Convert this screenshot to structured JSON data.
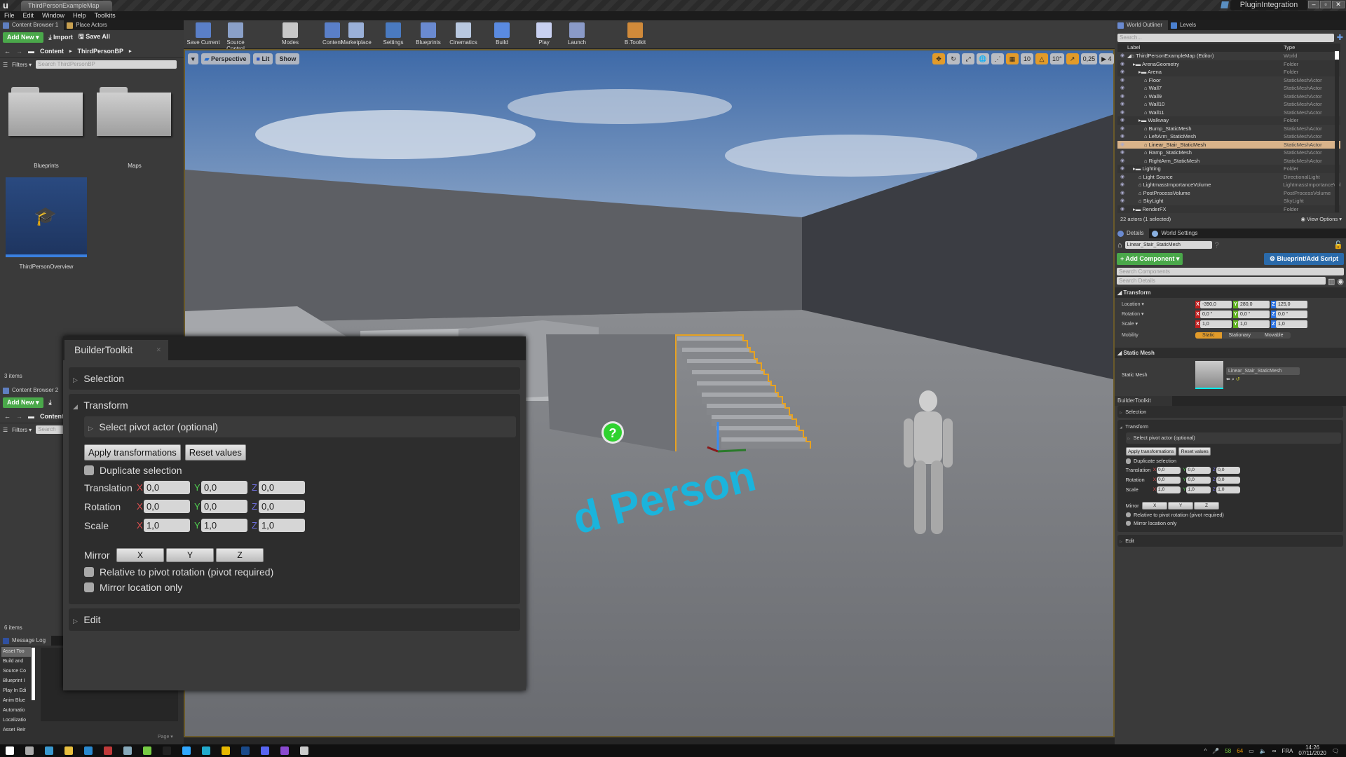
{
  "window": {
    "map_tab": "ThirdPersonExampleMap",
    "project_name": "PluginIntegration",
    "controls": [
      "minimize",
      "maximize",
      "close"
    ]
  },
  "menu": [
    "File",
    "Edit",
    "Window",
    "Help",
    "Toolkits"
  ],
  "content_browser_1": {
    "tabs": [
      {
        "label": "Content Browser 1"
      },
      {
        "label": "Place Actors"
      }
    ],
    "add_new": "Add New ▾",
    "import": "Import",
    "save_all": "Save All",
    "breadcrumb": [
      "Content",
      "ThirdPersonBP"
    ],
    "filters": "Filters ▾",
    "search_placeholder": "Search ThirdPersonBP",
    "assets": [
      {
        "label": "Blueprints",
        "type": "folder"
      },
      {
        "label": "Maps",
        "type": "folder"
      },
      {
        "label": "ThirdPersonOverview",
        "type": "tutorial"
      }
    ],
    "item_count": "3 items"
  },
  "content_browser_2": {
    "tab": "Content Browser 2",
    "add_new": "Add New ▾",
    "breadcrumb": [
      "Content"
    ],
    "filters": "Filters ▾",
    "search_placeholder": "Search",
    "item_count": "6 items"
  },
  "message_log": {
    "tab": "Message Log",
    "categories": [
      "Asset Too",
      "Build and",
      "Source Co",
      "Blueprint I",
      "Play In Edi",
      "Anim Blue",
      "Automatio",
      "Localizatio",
      "Asset Reir"
    ],
    "page_label": "Page ▾"
  },
  "toolbar": [
    {
      "label": "Save Current",
      "icon": "save-icon"
    },
    {
      "label": "Source Control",
      "icon": "source-control-icon"
    },
    {
      "label": "Modes",
      "icon": "modes-icon"
    },
    {
      "label": "Content",
      "icon": "content-icon"
    },
    {
      "label": "Marketplace",
      "icon": "marketplace-icon"
    },
    {
      "label": "Settings",
      "icon": "settings-icon"
    },
    {
      "label": "Blueprints",
      "icon": "blueprints-icon"
    },
    {
      "label": "Cinematics",
      "icon": "cinematics-icon"
    },
    {
      "label": "Build",
      "icon": "build-icon"
    },
    {
      "label": "Play",
      "icon": "play-icon"
    },
    {
      "label": "Launch",
      "icon": "launch-icon"
    },
    {
      "label": "B.Toolkit",
      "icon": "builder-toolkit-icon"
    }
  ],
  "viewport": {
    "left_buttons": [
      "▾",
      "Perspective",
      "Lit",
      "Show"
    ],
    "grid_snap": "10",
    "rotation_snap": "10°",
    "scale_snap": "0,25",
    "camera_speed": "4",
    "floor_text": "d Person"
  },
  "world_outliner": {
    "tabs": [
      "World Outliner",
      "Levels"
    ],
    "search_placeholder": "Search...",
    "columns": [
      "Label",
      "Type"
    ],
    "rows": [
      {
        "label": "ThirdPersonExampleMap (Editor)",
        "type": "World",
        "depth": 0
      },
      {
        "label": "ArenaGeometry",
        "type": "Folder",
        "depth": 1
      },
      {
        "label": "Arena",
        "type": "Folder",
        "depth": 2
      },
      {
        "label": "Floor",
        "type": "StaticMeshActor",
        "depth": 3
      },
      {
        "label": "Wall7",
        "type": "StaticMeshActor",
        "depth": 3
      },
      {
        "label": "Wall9",
        "type": "StaticMeshActor",
        "depth": 3
      },
      {
        "label": "Wall10",
        "type": "StaticMeshActor",
        "depth": 3
      },
      {
        "label": "Wall11",
        "type": "StaticMeshActor",
        "depth": 3
      },
      {
        "label": "Walkway",
        "type": "Folder",
        "depth": 2
      },
      {
        "label": "Bump_StaticMesh",
        "type": "StaticMeshActor",
        "depth": 3
      },
      {
        "label": "LeftArm_StaticMesh",
        "type": "StaticMeshActor",
        "depth": 3
      },
      {
        "label": "Linear_Stair_StaticMesh",
        "type": "StaticMeshActor",
        "depth": 3,
        "selected": true
      },
      {
        "label": "Ramp_StaticMesh",
        "type": "StaticMeshActor",
        "depth": 3
      },
      {
        "label": "RightArm_StaticMesh",
        "type": "StaticMeshActor",
        "depth": 3
      },
      {
        "label": "Lighting",
        "type": "Folder",
        "depth": 1
      },
      {
        "label": "Light Source",
        "type": "DirectionalLight",
        "depth": 2
      },
      {
        "label": "LightmassImportanceVolume",
        "type": "LightmassImportanceVol",
        "depth": 2
      },
      {
        "label": "PostProcessVolume",
        "type": "PostProcessVolume",
        "depth": 2
      },
      {
        "label": "SkyLight",
        "type": "SkyLight",
        "depth": 2
      },
      {
        "label": "RenderFX",
        "type": "Folder",
        "depth": 1
      }
    ],
    "status": "22 actors (1 selected)",
    "view_options": "View Options ▾"
  },
  "details": {
    "tabs": [
      "Details",
      "World Settings"
    ],
    "actor_name": "Linear_Stair_StaticMesh",
    "add_component": "+ Add Component ▾",
    "blueprint_script": "Blueprint/Add Script",
    "search_components": "Search Components",
    "search_details": "Search Details",
    "transform_header": "Transform",
    "location_label": "Location ▾",
    "location": [
      "-390,0",
      "280,0",
      "125,0"
    ],
    "rotation_label": "Rotation ▾",
    "rotation": [
      "0,0 °",
      "0,0 °",
      "0,0 °"
    ],
    "scale_label": "Scale ▾",
    "scale": [
      "1,0",
      "1,0",
      "1,0"
    ],
    "mobility_label": "Mobility",
    "mobility_options": [
      "Static",
      "Stationary",
      "Movable"
    ],
    "mobility_selected": "Static",
    "static_mesh_header": "Static Mesh",
    "static_mesh_label": "Static Mesh",
    "static_mesh_value": "Linear_Stair_StaticMesh"
  },
  "builder_toolkit": {
    "tab": "BuilderToolkit",
    "selection": "Selection",
    "transform": "Transform",
    "pivot": "Select pivot actor (optional)",
    "apply": "Apply transformations",
    "reset": "Reset values",
    "duplicate": "Duplicate selection",
    "translation_label": "Translation",
    "translation": [
      "0,0",
      "0,0",
      "0,0"
    ],
    "rotation_label": "Rotation",
    "rotation": [
      "0,0",
      "0,0",
      "0,0"
    ],
    "scale_label": "Scale",
    "scale": [
      "1,0",
      "1,0",
      "1,0"
    ],
    "mirror_label": "Mirror",
    "mirror_buttons": [
      "X",
      "Y",
      "Z"
    ],
    "relative_pivot": "Relative to pivot rotation (pivot required)",
    "mirror_location_only": "Mirror location only",
    "edit": "Edit",
    "axis_labels": [
      "X",
      "Y",
      "Z"
    ],
    "axis_colors": [
      "#e05050",
      "#50d050",
      "#7070e0"
    ]
  },
  "taskbar": {
    "apps": [
      "windows-start",
      "task-view",
      "edge",
      "file-explorer",
      "teamviewer",
      "app-circle",
      "photos",
      "notepad",
      "epic-games",
      "photoshop",
      "maya",
      "app-diamond",
      "substance",
      "discord",
      "visual-studio",
      "unreal-engine"
    ],
    "tray_gpu_temp": "58",
    "tray_cpu_temp": "64",
    "language": "FRA",
    "time": "14:26",
    "date": "07/11/2020"
  }
}
